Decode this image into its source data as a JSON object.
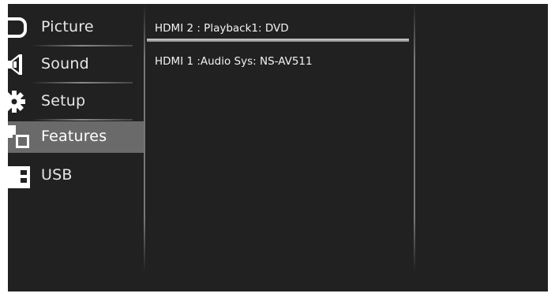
{
  "menu": {
    "items": [
      {
        "label": "Picture",
        "icon": "picture-icon"
      },
      {
        "label": "Sound",
        "icon": "speaker-icon"
      },
      {
        "label": "Setup",
        "icon": "gear-icon"
      },
      {
        "label": "Features",
        "icon": "features-icon",
        "active": true
      },
      {
        "label": "USB",
        "icon": "usb-icon"
      }
    ]
  },
  "list": {
    "items": [
      {
        "text": "HDMI 2 : Playback1: DVD",
        "selected": true
      },
      {
        "text": "HDMI 1 :Audio Sys: NS-AV511",
        "selected": false
      }
    ]
  },
  "colors": {
    "background": "#212121",
    "highlight": "#6a6a6a",
    "text": "#e6e6e6"
  }
}
